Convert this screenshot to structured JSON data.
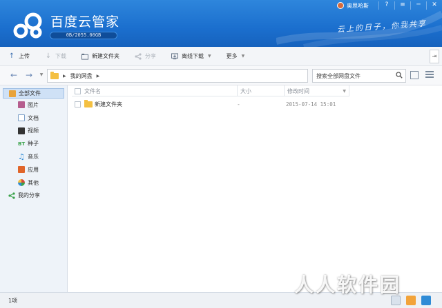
{
  "app": {
    "title": "百度云管家",
    "quota": "0B/2055.00GB",
    "slogan": "云上的日子，你我共享",
    "user": "奥思哈斯",
    "window_buttons": [
      "?",
      "≡",
      "─",
      "✕"
    ]
  },
  "toolbar": {
    "upload": "上传",
    "download": "下载",
    "new_folder": "新建文件夹",
    "share": "分享",
    "offline_download": "离线下载",
    "more": "更多"
  },
  "address": {
    "crumb": "我的网盘",
    "search_placeholder": "搜索全部网盘文件"
  },
  "sidebar": {
    "all_files": "全部文件",
    "items": [
      {
        "label": "图片",
        "color": "#b55d8e"
      },
      {
        "label": "文档",
        "color": "#7da0c8"
      },
      {
        "label": "视频",
        "color": "#333333"
      },
      {
        "label": "种子",
        "color": "#3aa24a"
      },
      {
        "label": "音乐",
        "color": "#2f8bd6"
      },
      {
        "label": "应用",
        "color": "#e0652a"
      },
      {
        "label": "其他",
        "color": "#d84a3a"
      }
    ],
    "share": "我的分享"
  },
  "table": {
    "headers": {
      "name": "文件名",
      "size": "大小",
      "modified": "修改时间"
    },
    "rows": [
      {
        "name": "新建文件夹",
        "size": "-",
        "modified": "2015-07-14 15:01"
      }
    ]
  },
  "status": {
    "count": "1项"
  },
  "watermark": "人人软件园",
  "colors": {
    "header": "#1b6fce",
    "folder": "#f4c042",
    "selection": "#cfe1f6"
  }
}
